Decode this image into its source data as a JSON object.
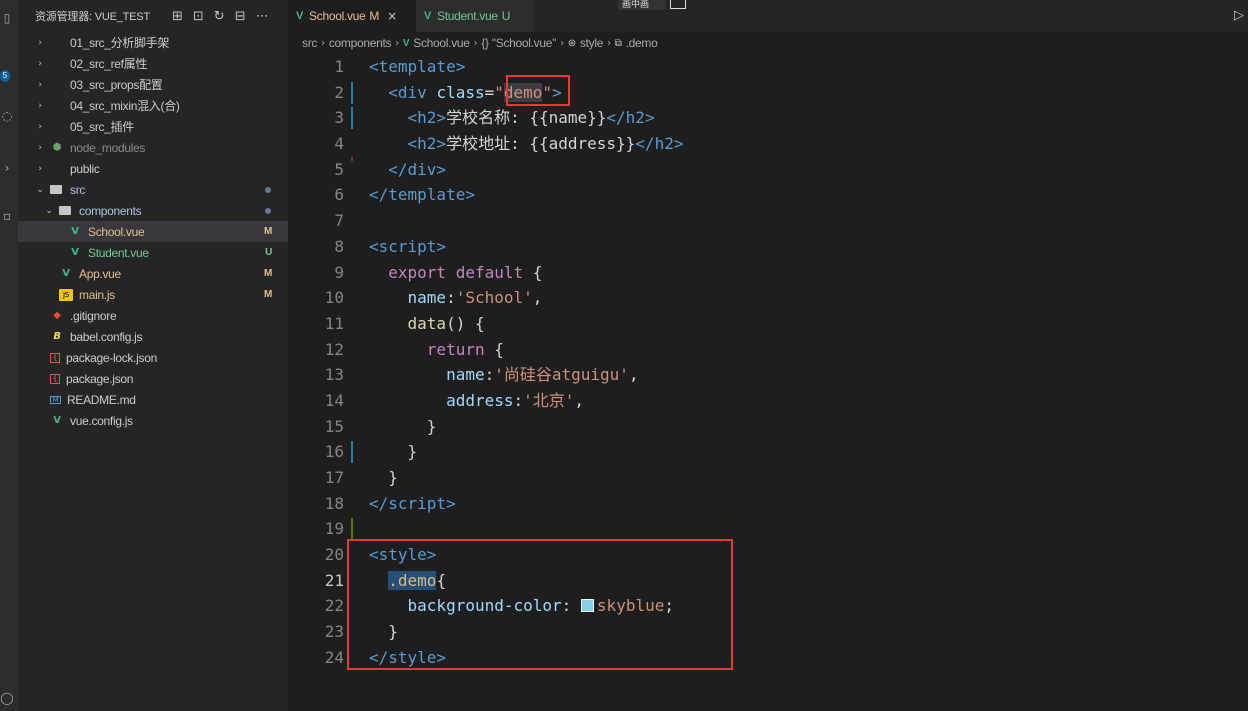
{
  "explorer": {
    "title": "资源管理器: VUE_TEST",
    "actions": [
      "new-file",
      "new-folder",
      "refresh",
      "collapse",
      "more"
    ],
    "items": [
      {
        "label": "01_src_分析脚手架",
        "kind": "folder",
        "expanded": false,
        "depth": 0
      },
      {
        "label": "02_src_ref属性",
        "kind": "folder",
        "expanded": false,
        "depth": 0
      },
      {
        "label": "03_src_props配置",
        "kind": "folder",
        "expanded": false,
        "depth": 0
      },
      {
        "label": "04_src_mixin混入(合)",
        "kind": "folder",
        "expanded": false,
        "depth": 0
      },
      {
        "label": "05_src_插件",
        "kind": "folder",
        "expanded": false,
        "depth": 0
      },
      {
        "label": "node_modules",
        "kind": "folder",
        "expanded": false,
        "depth": 0
      },
      {
        "label": "public",
        "kind": "folder",
        "expanded": false,
        "depth": 0
      },
      {
        "label": "src",
        "kind": "folder",
        "expanded": true,
        "depth": 0
      },
      {
        "label": "components",
        "kind": "folder",
        "expanded": true,
        "depth": 1
      },
      {
        "label": "School.vue",
        "kind": "vue",
        "depth": 2,
        "status": "M",
        "active": true
      },
      {
        "label": "Student.vue",
        "kind": "vue",
        "depth": 2,
        "status": "U"
      },
      {
        "label": "App.vue",
        "kind": "vue",
        "depth": 1,
        "status": "M"
      },
      {
        "label": "main.js",
        "kind": "js",
        "depth": 1,
        "status": "M"
      },
      {
        "label": ".gitignore",
        "kind": "git",
        "depth": 0
      },
      {
        "label": "babel.config.js",
        "kind": "babel",
        "depth": 0
      },
      {
        "label": "package-lock.json",
        "kind": "json",
        "depth": 0
      },
      {
        "label": "package.json",
        "kind": "json",
        "depth": 0
      },
      {
        "label": "README.md",
        "kind": "md",
        "depth": 0
      },
      {
        "label": "vue.config.js",
        "kind": "vue",
        "depth": 0
      }
    ]
  },
  "tabs": [
    {
      "label": "School.vue",
      "status": "M",
      "active": true
    },
    {
      "label": "Student.vue",
      "status": "U",
      "active": false
    }
  ],
  "pip_label": "画中画",
  "breadcrumb": [
    "src",
    "components",
    "School.vue",
    "{} \"School.vue\"",
    "style",
    ".demo"
  ],
  "code": {
    "lines": [
      {
        "n": "1",
        "html": "<span class='tag'>&lt;template&gt;</span>"
      },
      {
        "n": "2",
        "html": "  <span class='tag'>&lt;div</span> <span class='attr'>class</span><span class='punc'>=</span><span class='str'>\"<span class='demo-hl'>demo</span>\"</span><span class='tag'>&gt;</span>"
      },
      {
        "n": "3",
        "html": "    <span class='tag'>&lt;h2&gt;</span>学校名称: {{name}}<span class='tag'>&lt;/h2&gt;</span>"
      },
      {
        "n": "4",
        "html": "    <span class='tag'>&lt;h2&gt;</span>学校地址: {{address}}<span class='tag'>&lt;/h2&gt;</span>"
      },
      {
        "n": "5",
        "html": "  <span class='tag'>&lt;/div&gt;</span>"
      },
      {
        "n": "6",
        "html": "<span class='tag'>&lt;/template&gt;</span>"
      },
      {
        "n": "7",
        "html": ""
      },
      {
        "n": "8",
        "html": "<span class='tag'>&lt;script&gt;</span>"
      },
      {
        "n": "9",
        "html": "  <span class='kw'>export</span> <span class='kw'>default</span> {"
      },
      {
        "n": "10",
        "html": "    <span class='prop'>name</span>:<span class='str'>'School'</span>,"
      },
      {
        "n": "11",
        "html": "    <span class='fn'>data</span>() {"
      },
      {
        "n": "12",
        "html": "      <span class='kw'>return</span> {"
      },
      {
        "n": "13",
        "html": "        <span class='prop'>name</span>:<span class='str'>'尚硅谷atguigu'</span>,"
      },
      {
        "n": "14",
        "html": "        <span class='prop'>address</span>:<span class='str'>'北京'</span>,"
      },
      {
        "n": "15",
        "html": "      }"
      },
      {
        "n": "16",
        "html": "    }"
      },
      {
        "n": "17",
        "html": "  }"
      },
      {
        "n": "18",
        "html": "<span class='tag'>&lt;/script&gt;</span>"
      },
      {
        "n": "19",
        "html": ""
      },
      {
        "n": "20",
        "html": "<span class='tag'>&lt;style&gt;</span>"
      },
      {
        "n": "21",
        "html": "  <span class='sel sel-hl'>.demo</span>{"
      },
      {
        "n": "22",
        "html": "    <span class='prop'>background-color</span>: <span class='swatch'></span><span class='str'>skyblue</span>;"
      },
      {
        "n": "23",
        "html": "  }"
      },
      {
        "n": "24",
        "html": "<span class='tag'>&lt;/style&gt;</span>"
      }
    ],
    "current_line": "21"
  },
  "colors": {
    "accent_box": "#e53935",
    "swatch": "#87ceeb"
  }
}
